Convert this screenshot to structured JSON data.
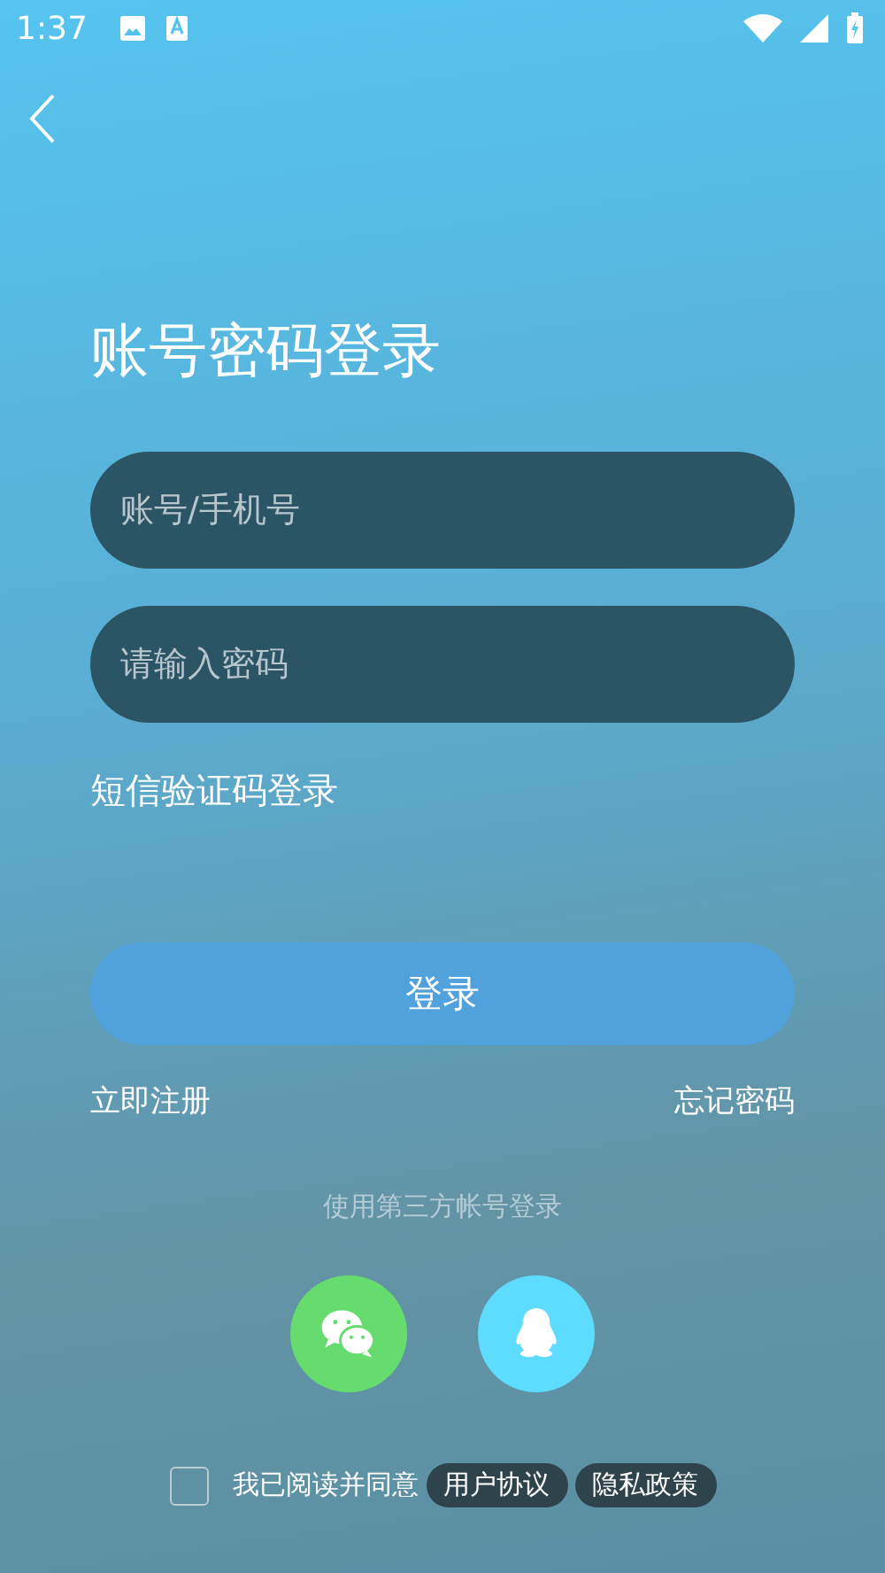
{
  "status_bar": {
    "time": "1:37"
  },
  "title": "账号密码登录",
  "account_field": {
    "placeholder": "账号/手机号"
  },
  "password_field": {
    "placeholder": "请输入密码"
  },
  "sms_login_link": "短信验证码登录",
  "login_button": "登录",
  "register_link": "立即注册",
  "forgot_password_link": "忘记密码",
  "third_party_label": "使用第三方帐号登录",
  "third_party": [
    {
      "kind": "wechat",
      "color": "#66dc6e"
    },
    {
      "kind": "qq",
      "color": "#5ddcfd"
    }
  ],
  "agreement": {
    "checked": false,
    "text": "我已阅读并同意",
    "links": [
      "用户协议",
      "隐私政策"
    ]
  }
}
